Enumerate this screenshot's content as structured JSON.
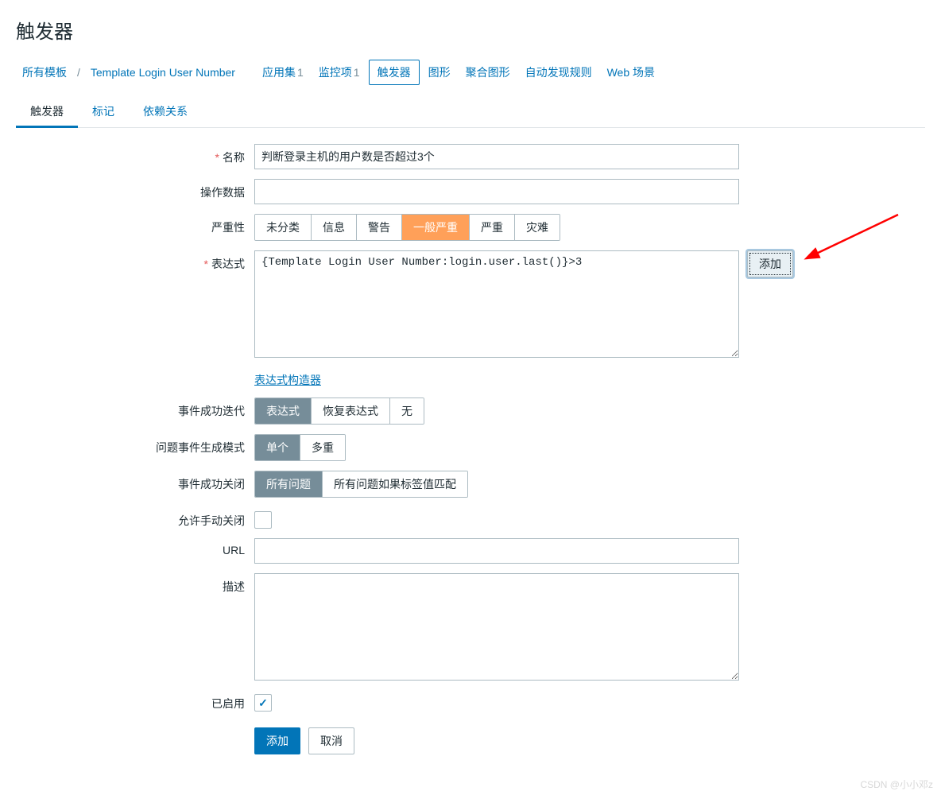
{
  "page_title": "触发器",
  "breadcrumb": {
    "all_templates": "所有模板",
    "template_name": "Template Login User Number",
    "items": [
      {
        "label": "应用集",
        "count": "1"
      },
      {
        "label": "监控项",
        "count": "1"
      },
      {
        "label": "触发器",
        "count": "",
        "active": true
      },
      {
        "label": "图形",
        "count": ""
      },
      {
        "label": "聚合图形",
        "count": ""
      },
      {
        "label": "自动发现规则",
        "count": ""
      },
      {
        "label": "Web 场景",
        "count": ""
      }
    ]
  },
  "tabs": {
    "trigger": "触发器",
    "tags": "标记",
    "dependencies": "依赖关系"
  },
  "form": {
    "name_label": "名称",
    "name_value": "判断登录主机的用户数是否超过3个",
    "operdata_label": "操作数据",
    "operdata_value": "",
    "severity_label": "严重性",
    "severity_options": [
      "未分类",
      "信息",
      "警告",
      "一般严重",
      "严重",
      "灾难"
    ],
    "severity_selected": 3,
    "expression_label": "表达式",
    "expression_value": "{Template Login User Number:login.user.last()}>3",
    "expression_add_btn": "添加",
    "expression_builder_link": "表达式构造器",
    "event_ok_label": "事件成功迭代",
    "event_ok_options": [
      "表达式",
      "恢复表达式",
      "无"
    ],
    "event_gen_label": "问题事件生成模式",
    "event_gen_options": [
      "单个",
      "多重"
    ],
    "event_close_label": "事件成功关闭",
    "event_close_options": [
      "所有问题",
      "所有问题如果标签值匹配"
    ],
    "manual_close_label": "允许手动关闭",
    "url_label": "URL",
    "url_value": "",
    "description_label": "描述",
    "description_value": "",
    "enabled_label": "已启用",
    "enabled_checked": true,
    "submit_btn": "添加",
    "cancel_btn": "取消"
  },
  "watermark": "CSDN @小小邓z"
}
